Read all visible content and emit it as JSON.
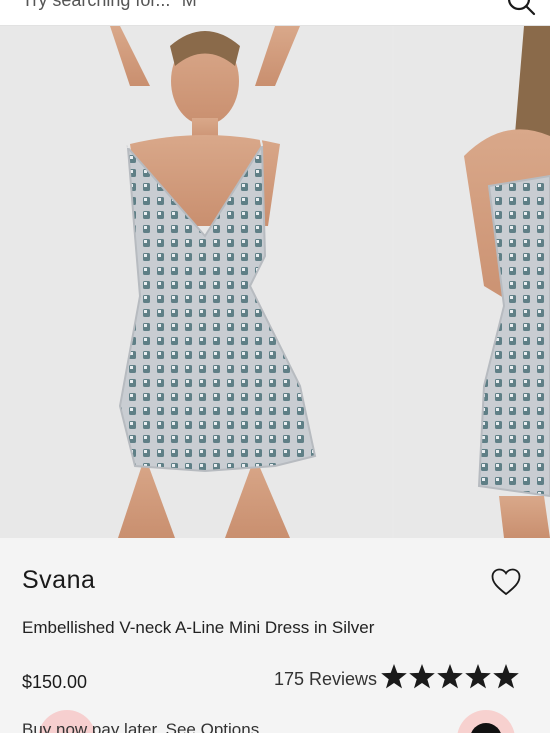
{
  "search": {
    "placeholder": "Try searching for... \"M"
  },
  "product": {
    "brand": "Svana",
    "title": "Embellished V-neck A-Line Mini Dress in Silver",
    "price": "$150.00",
    "reviews_label": "175 Reviews",
    "rating": 5,
    "rating_max": 5,
    "bnpl_text": "Buy now pay later. See Options"
  },
  "icons": {
    "search": "search-icon",
    "wishlist": "heart-outline-icon",
    "star": "star-icon",
    "chat": "chat-icon"
  },
  "colors": {
    "background": "#f4f4f4",
    "text": "#1a1a1a",
    "star": "#1a1a1a",
    "accent_pink": "#f6cfcf"
  }
}
